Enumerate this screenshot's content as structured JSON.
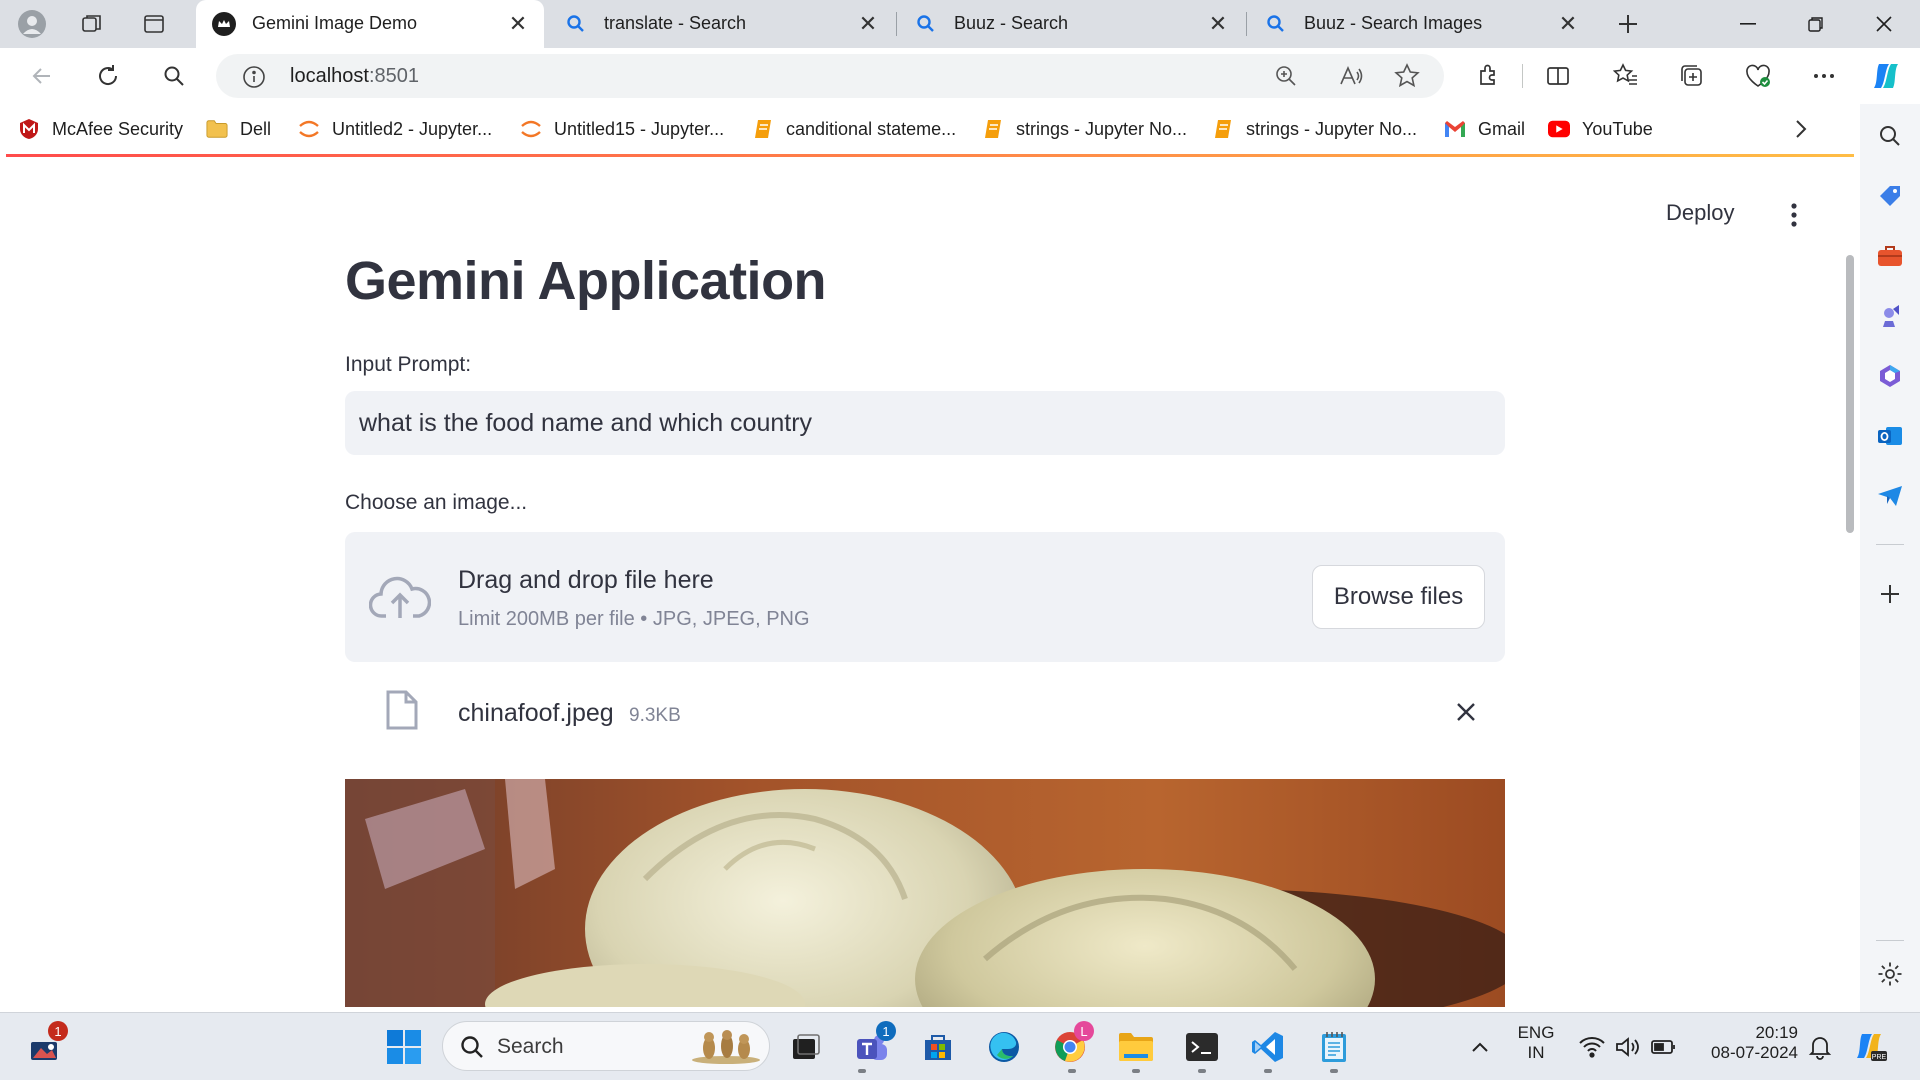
{
  "browser": {
    "tabs": [
      {
        "title": "Gemini Image Demo",
        "active": true
      },
      {
        "title": "translate - Search",
        "active": false
      },
      {
        "title": "Buuz - Search",
        "active": false
      },
      {
        "title": "Buuz - Search Images",
        "active": false
      }
    ],
    "address": {
      "host": "localhost",
      "port": ":8501"
    },
    "bookmarks": [
      {
        "label": "McAfee Security",
        "icon": "mcafee-icon"
      },
      {
        "label": "Dell",
        "icon": "folder-icon"
      },
      {
        "label": "Untitled2 - Jupyter...",
        "icon": "jupyter-icon"
      },
      {
        "label": "Untitled15 - Jupyter...",
        "icon": "jupyter-icon"
      },
      {
        "label": "canditional stateme...",
        "icon": "notebook-icon"
      },
      {
        "label": "strings - Jupyter No...",
        "icon": "notebook-icon"
      },
      {
        "label": "strings - Jupyter No...",
        "icon": "notebook-icon"
      },
      {
        "label": "Gmail",
        "icon": "gmail-icon"
      },
      {
        "label": "YouTube",
        "icon": "youtube-icon"
      }
    ]
  },
  "app": {
    "deploy_label": "Deploy",
    "title": "Gemini Application",
    "prompt_label": "Input Prompt:",
    "prompt_value": "what is the food name and which country",
    "uploader_label": "Choose an image...",
    "dropzone_title": "Drag and drop file here",
    "dropzone_sub": "Limit 200MB per file • JPG, JPEG, PNG",
    "browse_label": "Browse files",
    "file": {
      "name": "chinafoof.jpeg",
      "size": "9.3KB"
    }
  },
  "taskbar": {
    "search_placeholder": "Search",
    "lang_line1": "ENG",
    "lang_line2": "IN",
    "time": "20:19",
    "date": "08-07-2024",
    "badges": {
      "widgets": "1",
      "teams": "1",
      "chrome_profile": "L"
    }
  },
  "colors": {
    "accent_red": "#ff4b4b",
    "accent_yellow": "#ffbd45",
    "input_bg": "#f0f2f6",
    "text": "#31333f",
    "muted": "#808495"
  }
}
